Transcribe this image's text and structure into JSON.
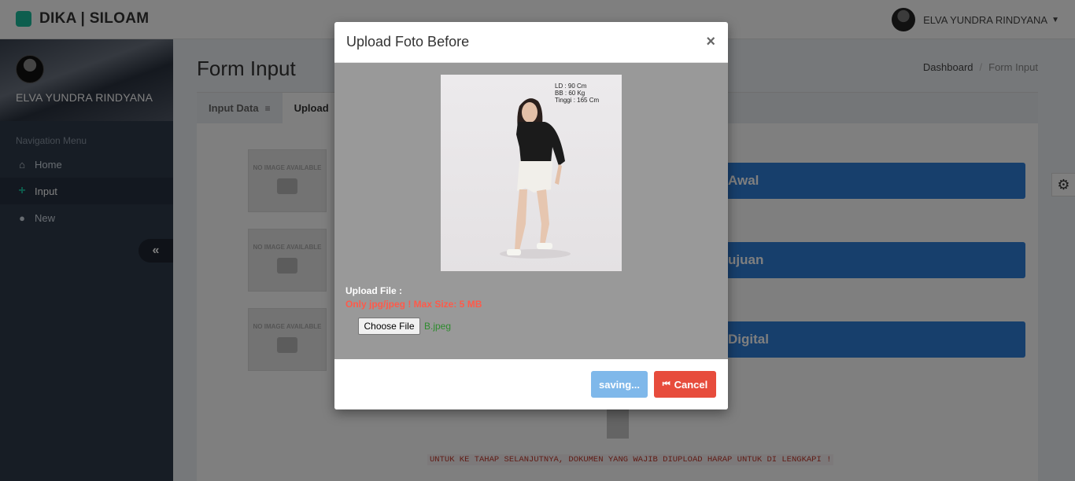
{
  "app": {
    "brand": "DIKA | SILOAM"
  },
  "user": {
    "name": "ELVA YUNDRA RINDYANA"
  },
  "sidebar": {
    "profile_name": "ELVA YUNDRA RINDYANA",
    "nav_header": "Navigation Menu",
    "items": [
      {
        "label": "Home",
        "icon": "home-icon"
      },
      {
        "label": "Input",
        "icon": "plus-icon",
        "active": true
      },
      {
        "label": "New",
        "icon": "user-icon"
      }
    ],
    "collapse_glyph": "«"
  },
  "page": {
    "title": "Form Input",
    "breadcrumb": [
      "Dashboard",
      "Form Input"
    ]
  },
  "panel": {
    "tabs": [
      {
        "label": "Input Data",
        "icon": "database-icon"
      },
      {
        "label": "Upload",
        "active": true
      }
    ],
    "no_image_text": "NO IMAGE AVAILABLE",
    "buttons": [
      "Awal",
      "ujuan",
      "Digital"
    ],
    "warning": "UNTUK KE TAHAP SELANJUTNYA, DOKUMEN YANG WAJIB DIUPLOAD HARAP UNTUK DI LENGKAPI !"
  },
  "modal": {
    "title": "Upload Foto Before",
    "close": "×",
    "photo_note": [
      "LD : 90 Cm",
      "BB : 60 Kg",
      "Tinggi : 165 Cm"
    ],
    "upload_label": "Upload File :",
    "upload_hint": "Only jpg/jpeg ! Max Size: 5 MB",
    "choose_file": "Choose File",
    "file_name": "B.jpeg",
    "saving_label": "saving...",
    "cancel_label": "Cancel"
  },
  "colors": {
    "accent": "#1abc9c",
    "primary_button": "#2f7ed8",
    "cancel": "#e74c3c",
    "saving": "#7fb8ea",
    "hint": "#ff5a4a",
    "file_name": "#2e8b2e"
  }
}
